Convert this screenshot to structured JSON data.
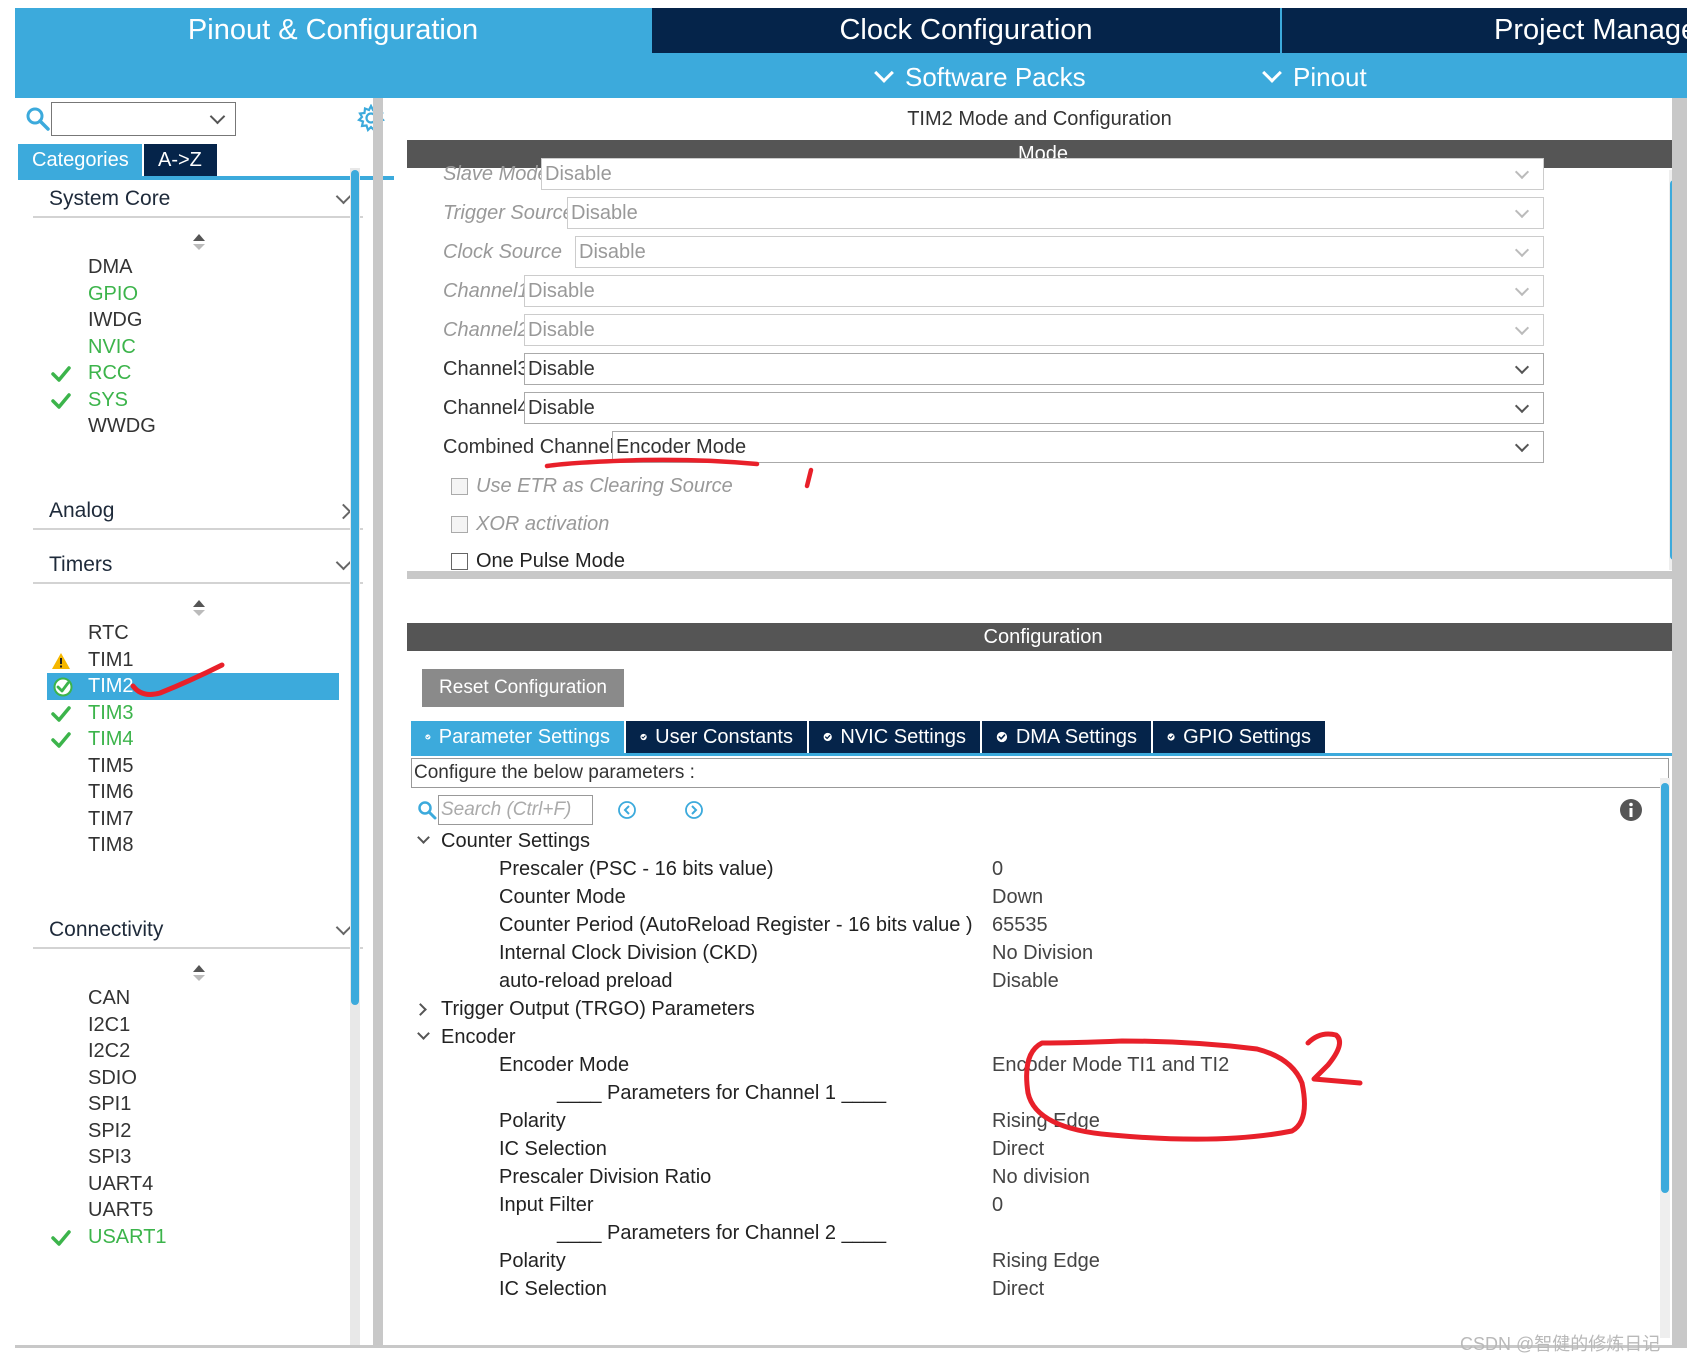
{
  "top_tabs": {
    "pinout": "Pinout & Configuration",
    "clock": "Clock Configuration",
    "project": "Project Manage"
  },
  "sub_menus": {
    "software_packs": "Software Packs",
    "pinout": "Pinout"
  },
  "left": {
    "tabs": {
      "categories": "Categories",
      "az": "A->Z"
    },
    "system_core": {
      "title": "System Core",
      "items": [
        {
          "label": "DMA",
          "state": "none"
        },
        {
          "label": "GPIO",
          "state": "green"
        },
        {
          "label": "IWDG",
          "state": "none"
        },
        {
          "label": "NVIC",
          "state": "green"
        },
        {
          "label": "RCC",
          "state": "check"
        },
        {
          "label": "SYS",
          "state": "check"
        },
        {
          "label": "WWDG",
          "state": "none"
        }
      ]
    },
    "analog": {
      "title": "Analog"
    },
    "timers": {
      "title": "Timers",
      "items": [
        {
          "label": "RTC",
          "state": "none"
        },
        {
          "label": "TIM1",
          "state": "warning"
        },
        {
          "label": "TIM2",
          "state": "selected"
        },
        {
          "label": "TIM3",
          "state": "check"
        },
        {
          "label": "TIM4",
          "state": "check"
        },
        {
          "label": "TIM5",
          "state": "none"
        },
        {
          "label": "TIM6",
          "state": "none"
        },
        {
          "label": "TIM7",
          "state": "none"
        },
        {
          "label": "TIM8",
          "state": "none"
        }
      ]
    },
    "connectivity": {
      "title": "Connectivity",
      "items": [
        {
          "label": "CAN",
          "state": "none"
        },
        {
          "label": "I2C1",
          "state": "none"
        },
        {
          "label": "I2C2",
          "state": "none"
        },
        {
          "label": "SDIO",
          "state": "none"
        },
        {
          "label": "SPI1",
          "state": "none"
        },
        {
          "label": "SPI2",
          "state": "none"
        },
        {
          "label": "SPI3",
          "state": "none"
        },
        {
          "label": "UART4",
          "state": "none"
        },
        {
          "label": "UART5",
          "state": "none"
        },
        {
          "label": "USART1",
          "state": "check"
        }
      ]
    }
  },
  "panel_title": "TIM2 Mode and Configuration",
  "mode": {
    "header": "Mode",
    "fields": [
      {
        "label": "Slave Mode",
        "value": "Disable",
        "enabled": false
      },
      {
        "label": "Trigger Source",
        "value": "Disable",
        "enabled": false
      },
      {
        "label": "Clock Source",
        "value": "Disable",
        "enabled": false
      },
      {
        "label": "Channel1",
        "value": "Disable",
        "enabled": false
      },
      {
        "label": "Channel2",
        "value": "Disable",
        "enabled": false
      },
      {
        "label": "Channel3",
        "value": "Disable",
        "enabled": true
      },
      {
        "label": "Channel4",
        "value": "Disable",
        "enabled": true
      },
      {
        "label": "Combined Channels",
        "value": "Encoder Mode",
        "enabled": true
      }
    ],
    "checkboxes": [
      {
        "label": "Use ETR as Clearing Source",
        "enabled": false
      },
      {
        "label": "XOR activation",
        "enabled": false
      },
      {
        "label": "One Pulse Mode",
        "enabled": true
      }
    ]
  },
  "configuration": {
    "header": "Configuration",
    "reset_label": "Reset Configuration",
    "tabs": [
      "Parameter Settings",
      "User Constants",
      "NVIC Settings",
      "DMA Settings",
      "GPIO Settings"
    ],
    "banner": "Configure the below parameters :",
    "search_placeholder": "Search (Ctrl+F)",
    "tree": {
      "counter_settings": {
        "title": "Counter Settings",
        "params": [
          {
            "name": "Prescaler (PSC - 16 bits value)",
            "value": "0"
          },
          {
            "name": "Counter Mode",
            "value": "Down"
          },
          {
            "name": "Counter Period (AutoReload Register - 16 bits value )",
            "value": "65535"
          },
          {
            "name": "Internal Clock Division (CKD)",
            "value": "No Division"
          },
          {
            "name": "auto-reload preload",
            "value": "Disable"
          }
        ]
      },
      "trgo": {
        "title": "Trigger Output (TRGO) Parameters"
      },
      "encoder": {
        "title": "Encoder",
        "mode": {
          "name": "Encoder Mode",
          "value": "Encoder Mode TI1 and TI2"
        },
        "ch1_header": "____ Parameters for Channel 1 ____",
        "ch1": [
          {
            "name": "Polarity",
            "value": "Rising Edge"
          },
          {
            "name": "IC Selection",
            "value": "Direct"
          },
          {
            "name": "Prescaler Division Ratio",
            "value": "No division"
          },
          {
            "name": "Input Filter",
            "value": "0"
          }
        ],
        "ch2_header": "____ Parameters for Channel 2 ____",
        "ch2": [
          {
            "name": "Polarity",
            "value": "Rising Edge"
          },
          {
            "name": "IC Selection",
            "value": "Direct"
          }
        ]
      }
    }
  },
  "watermark": "CSDN @智健的修炼日记",
  "colors": {
    "accent_blue": "#3caadc",
    "dark_navy": "#05244a",
    "section_gray": "#555555",
    "check_green": "#3cb44b",
    "ink_red": "#e8202a"
  }
}
